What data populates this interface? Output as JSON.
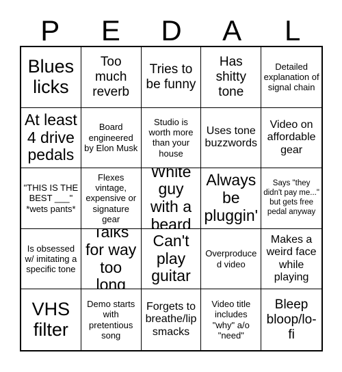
{
  "card": {
    "title_letters": [
      "P",
      "E",
      "D",
      "A",
      "L"
    ],
    "grid_size": "5x5",
    "colors": {
      "text": "#000000",
      "background": "#ffffff",
      "border": "#000000"
    },
    "rows": [
      [
        {
          "text": "Blues licks",
          "size": "sz-xxl"
        },
        {
          "text": "Too much reverb",
          "size": "sz-lg"
        },
        {
          "text": "Tries to be funny",
          "size": "sz-lg"
        },
        {
          "text": "Has shitty tone",
          "size": "sz-lg"
        },
        {
          "text": "Detailed explanation of signal chain",
          "size": "sz-sm"
        }
      ],
      [
        {
          "text": "At least 4 drive pedals",
          "size": "sz-xl"
        },
        {
          "text": "Board engineered by Elon Musk",
          "size": "sz-sm"
        },
        {
          "text": "Studio is worth more than your house",
          "size": "sz-sm"
        },
        {
          "text": "Uses tone buzzwords",
          "size": "sz-md"
        },
        {
          "text": "Video on affordable gear",
          "size": "sz-md"
        }
      ],
      [
        {
          "text": "\"THIS IS THE BEST ___\" *wets pants*",
          "size": "sz-sm"
        },
        {
          "text": "Flexes vintage, expensive or signature gear",
          "size": "sz-sm"
        },
        {
          "text": "White guy with a beard",
          "size": "sz-xl"
        },
        {
          "text": "Always be pluggin'",
          "size": "sz-xl"
        },
        {
          "text": "Says \"they didn't pay me...\" but gets free pedal anyway",
          "size": "sz-xs"
        }
      ],
      [
        {
          "text": "Is obsessed w/ imitating a specific tone",
          "size": "sz-sm"
        },
        {
          "text": "Talks for way too long",
          "size": "sz-xl"
        },
        {
          "text": "Can't play guitar",
          "size": "sz-xl"
        },
        {
          "text": "Overproduced video",
          "size": "sz-sm"
        },
        {
          "text": "Makes a weird face while playing",
          "size": "sz-md"
        }
      ],
      [
        {
          "text": "VHS filter",
          "size": "sz-xxl"
        },
        {
          "text": "Demo starts with pretentious song",
          "size": "sz-sm"
        },
        {
          "text": "Forgets to breathe/lip smacks",
          "size": "sz-md"
        },
        {
          "text": "Video title includes \"why\" a/o \"need\"",
          "size": "sz-sm"
        },
        {
          "text": "Bleep bloop/lo-fi",
          "size": "sz-lg"
        }
      ]
    ]
  }
}
